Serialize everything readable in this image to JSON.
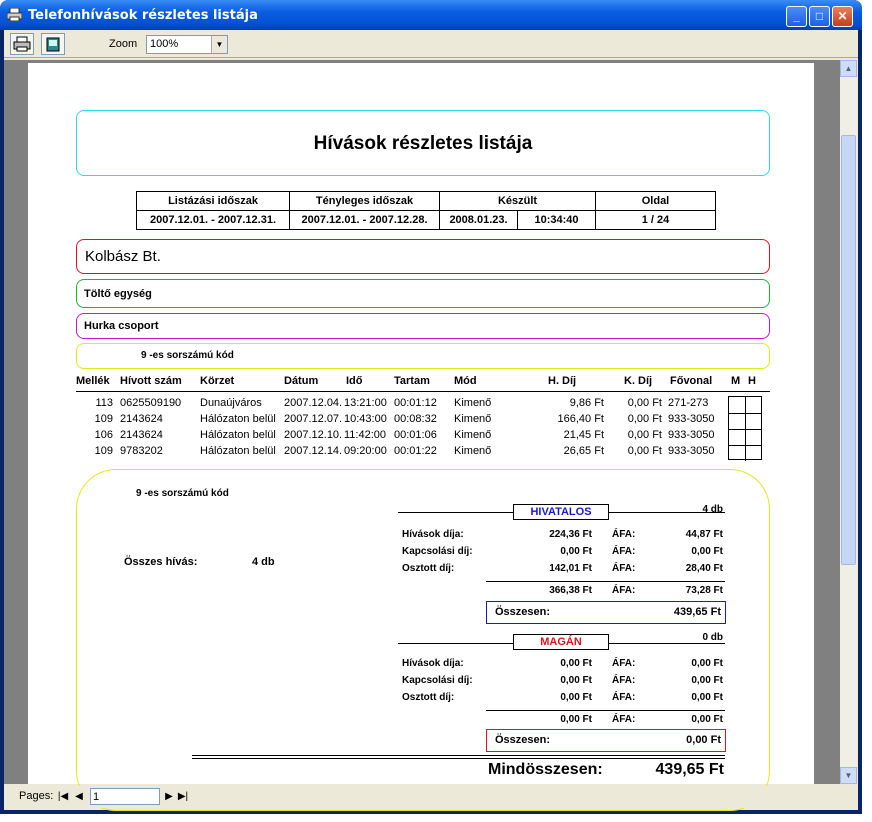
{
  "window": {
    "title": "Telefonhívások részletes listája",
    "min": "_",
    "max": "□",
    "close": "✕"
  },
  "toolbar": {
    "zoom_label": "Zoom",
    "zoom_value": "100%"
  },
  "status": {
    "pages_label": "Pages:",
    "page_input": "1"
  },
  "report": {
    "title": "Hívások részletes listája",
    "info_headers": [
      "Listázási időszak",
      "Tényleges időszak",
      "Készült",
      "Oldal"
    ],
    "info_values": [
      "2007.12.01. - 2007.12.31.",
      "2007.12.01. - 2007.12.28.",
      "2008.01.23.",
      "10:34:40",
      "1 / 24"
    ],
    "company": "Kolbász Bt.",
    "unit": "Töltő egység",
    "group": "Hurka csoport",
    "code": "9  -es sorszámú kód",
    "columns": [
      "Mellék",
      "Hívott szám",
      "Körzet",
      "Dátum",
      "Idő",
      "Tartam",
      "Mód",
      "H. Díj",
      "K. Díj",
      "Fővonal",
      "M",
      "H"
    ],
    "rows": [
      [
        "113",
        "0625509190",
        "Dunaújváros",
        "2007.12.04.",
        "13:21:00",
        "00:01:12",
        "Kimenő",
        "9,86 Ft",
        "0,00 Ft",
        "271-273"
      ],
      [
        "109",
        "2143624",
        "Hálózaton belül",
        "2007.12.07.",
        "10:43:00",
        "00:08:32",
        "Kimenő",
        "166,40 Ft",
        "0,00 Ft",
        "933-3050"
      ],
      [
        "106",
        "2143624",
        "Hálózaton belül",
        "2007.12.10.",
        "11:42:00",
        "00:01:06",
        "Kimenő",
        "21,45 Ft",
        "0,00 Ft",
        "933-3050"
      ],
      [
        "109",
        "9783202",
        "Hálózaton belül",
        "2007.12.14.",
        "09:20:00",
        "00:01:22",
        "Kimenő",
        "26,65 Ft",
        "0,00 Ft",
        "933-3050"
      ]
    ],
    "summary": {
      "code": "9  -es sorszámú kód",
      "total_calls_label": "Összes hívás:",
      "total_calls": "4 db",
      "official": {
        "label": "HIVATALOS",
        "count": "4 db",
        "rows": [
          [
            "Hívások díja:",
            "224,36 Ft",
            "ÁFA:",
            "44,87 Ft"
          ],
          [
            "Kapcsolási díj:",
            "0,00 Ft",
            "ÁFA:",
            "0,00 Ft"
          ],
          [
            "Osztott díj:",
            "142,01 Ft",
            "ÁFA:",
            "28,40 Ft"
          ]
        ],
        "subtotal": [
          "366,38 Ft",
          "ÁFA:",
          "73,28 Ft"
        ],
        "total_label": "Összesen:",
        "total": "439,65 Ft"
      },
      "private": {
        "label": "MAGÁN",
        "count": "0 db",
        "rows": [
          [
            "Hívások díja:",
            "0,00 Ft",
            "ÁFA:",
            "0,00 Ft"
          ],
          [
            "Kapcsolási díj:",
            "0,00 Ft",
            "ÁFA:",
            "0,00 Ft"
          ],
          [
            "Osztott díj:",
            "0,00 Ft",
            "ÁFA:",
            "0,00 Ft"
          ]
        ],
        "subtotal": [
          "0,00 Ft",
          "ÁFA:",
          "0,00 Ft"
        ],
        "total_label": "Összesen:",
        "total": "0,00 Ft"
      },
      "grand_label": "Mindösszesen:",
      "grand_total": "439,65 Ft"
    }
  },
  "colors": {
    "official": "#1a1acc",
    "private": "#e3131d"
  }
}
